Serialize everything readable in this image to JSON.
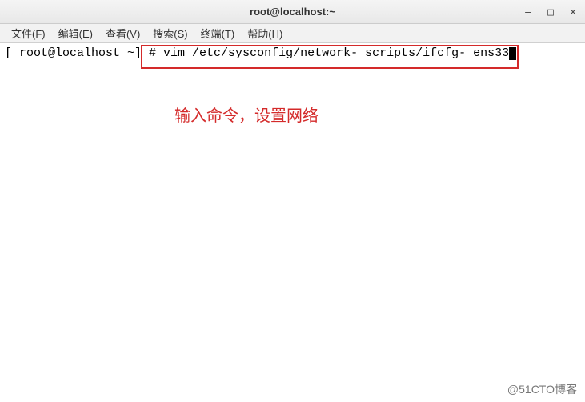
{
  "titlebar": {
    "title": "root@localhost:~"
  },
  "window_controls": {
    "minimize": "—",
    "maximize": "□",
    "close": "×"
  },
  "menubar": {
    "file": "文件(F)",
    "edit": "编辑(E)",
    "view": "查看(V)",
    "search": "搜索(S)",
    "terminal": "终端(T)",
    "help": "帮助(H)"
  },
  "terminal": {
    "prompt": "[ root@localhost ~] # ",
    "command": "vim /etc/sysconfig/network- scripts/ifcfg- ens33"
  },
  "annotation": {
    "text": "输入命令，设置网络"
  },
  "watermark": {
    "text": "@51CTO博客"
  }
}
